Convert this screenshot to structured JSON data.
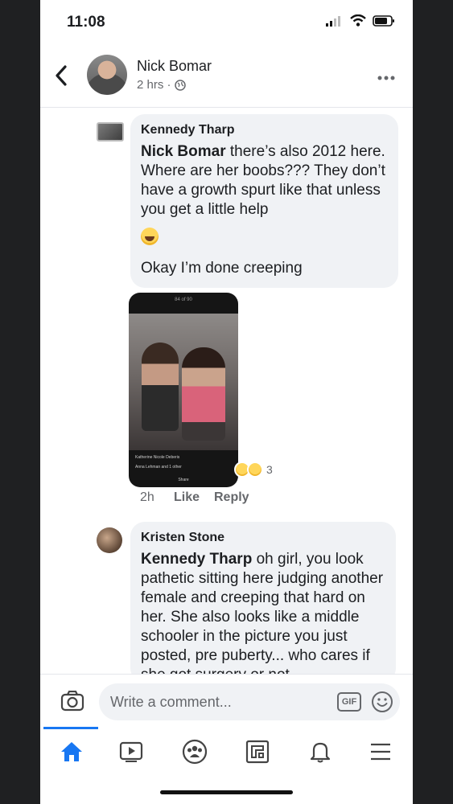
{
  "status_bar": {
    "time": "11:08"
  },
  "header": {
    "back_icon": "chevron-left-icon",
    "name": "Nick Bomar",
    "meta": "2 hrs ·",
    "privacy_icon": "globe-icon",
    "more_icon": "more-dots-icon"
  },
  "comments": [
    {
      "author": "Kennedy Tharp",
      "mention": "Nick Bomar",
      "text_after_mention": " there’s also 2012 here. Where are her boobs??? They don’t have a growth spurt like that unless you get a little help",
      "emoji": "laughing-crying-emoji",
      "text2": "Okay I’m done creeping",
      "photo": {
        "top_text": "84 of 90",
        "caption_1": "Katherine Nicole Deberis",
        "caption_2": "Anna Lehman and 1 other",
        "caption_3": "Share"
      },
      "reactions": {
        "count": "3",
        "types": [
          "haha",
          "wow"
        ]
      },
      "actions": {
        "time": "2h",
        "like": "Like",
        "reply": "Reply"
      }
    },
    {
      "author": "Kristen Stone",
      "mention": "Kennedy Tharp",
      "text_after_mention": " oh girl, you look pathetic sitting here judging another female and creeping that hard on her. She also looks like a middle schooler in the picture you just posted, pre puberty... who cares if she got surgery or not"
    }
  ],
  "composer": {
    "placeholder": "Write a comment...",
    "gif_label": "GIF",
    "camera_icon": "camera-icon",
    "emoji_icon": "smiley-icon"
  },
  "nav": {
    "items": [
      "home-icon",
      "watch-icon",
      "groups-icon",
      "pages-icon",
      "notifications-icon",
      "menu-icon"
    ],
    "active_color": "#1877f2"
  }
}
